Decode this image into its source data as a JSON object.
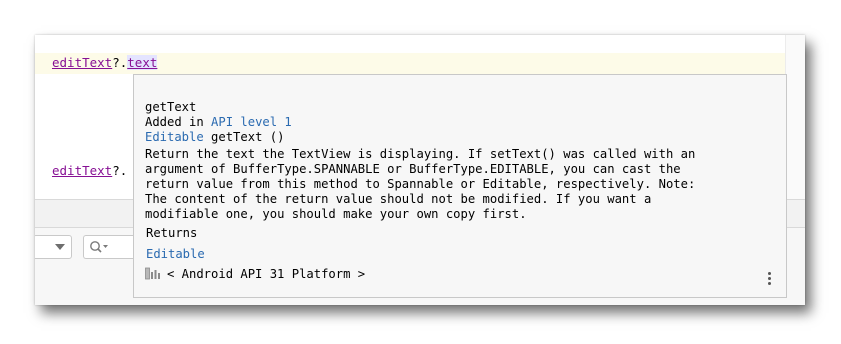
{
  "editor": {
    "line1": {
      "receiver": "editText",
      "operator": "?.",
      "property": "text"
    },
    "line2": {
      "receiver": "editText",
      "operator": "?."
    }
  },
  "doc_popup": {
    "signature_name": "getText",
    "added_prefix": "Added in ",
    "api_link": "API level 1",
    "return_type": "Editable",
    "method_sig": " getText ()",
    "description_lines": [
      "Return the text the TextView is displaying. If setText() was called with an",
      "argument of BufferType.SPANNABLE or BufferType.EDITABLE, you can cast the",
      "return value from this method to Spannable or Editable, respectively. Note:",
      "The content of the return value should not be modified. If you want a",
      "modifiable one, you should make your own copy first."
    ],
    "returns_label": "Returns",
    "returns_type": "Editable",
    "footer_text": "< Android API 31 Platform >"
  },
  "icons": {
    "library": "library-icon",
    "more": "more-options-icon",
    "search": "search-icon",
    "dropdown": "chevron-down-icon"
  },
  "colors": {
    "identifier": "#871094",
    "link": "#2a6ab0",
    "caret_line": "#fdfbe8",
    "popup_bg": "#f7f7f7"
  }
}
